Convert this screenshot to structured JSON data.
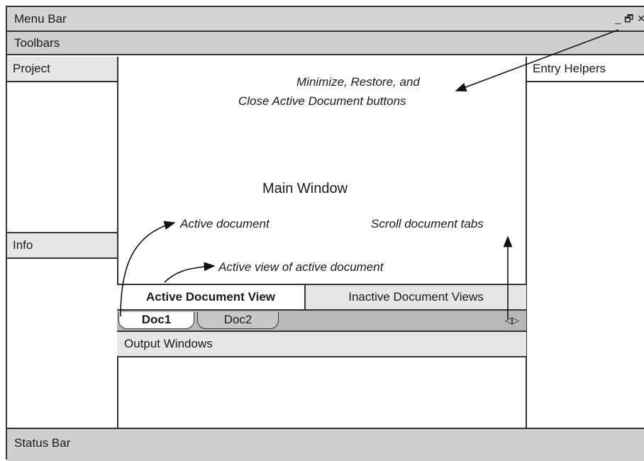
{
  "menu_bar": {
    "label": "Menu Bar"
  },
  "window_controls": {
    "minimize": "_",
    "restore": "🗗",
    "close": "✕"
  },
  "toolbars": {
    "label": "Toolbars"
  },
  "panels": {
    "project": "Project",
    "info": "Info",
    "entry_helpers": "Entry Helpers"
  },
  "main": {
    "title": "Main Window"
  },
  "annotations": {
    "buttons_line1": "Minimize, Restore, and",
    "buttons_line2": "Close Active Document buttons",
    "active_document": "Active document",
    "scroll_tabs": "Scroll document tabs",
    "active_view": "Active view of active document"
  },
  "document_views": {
    "active": "Active Document View",
    "inactive": "Inactive Document Views"
  },
  "tabs": [
    "Doc1",
    "Doc2"
  ],
  "scroll_buttons": {
    "left": "◁",
    "right": "▷"
  },
  "output_windows": {
    "label": "Output Windows"
  },
  "status_bar": {
    "label": "Status Bar"
  }
}
